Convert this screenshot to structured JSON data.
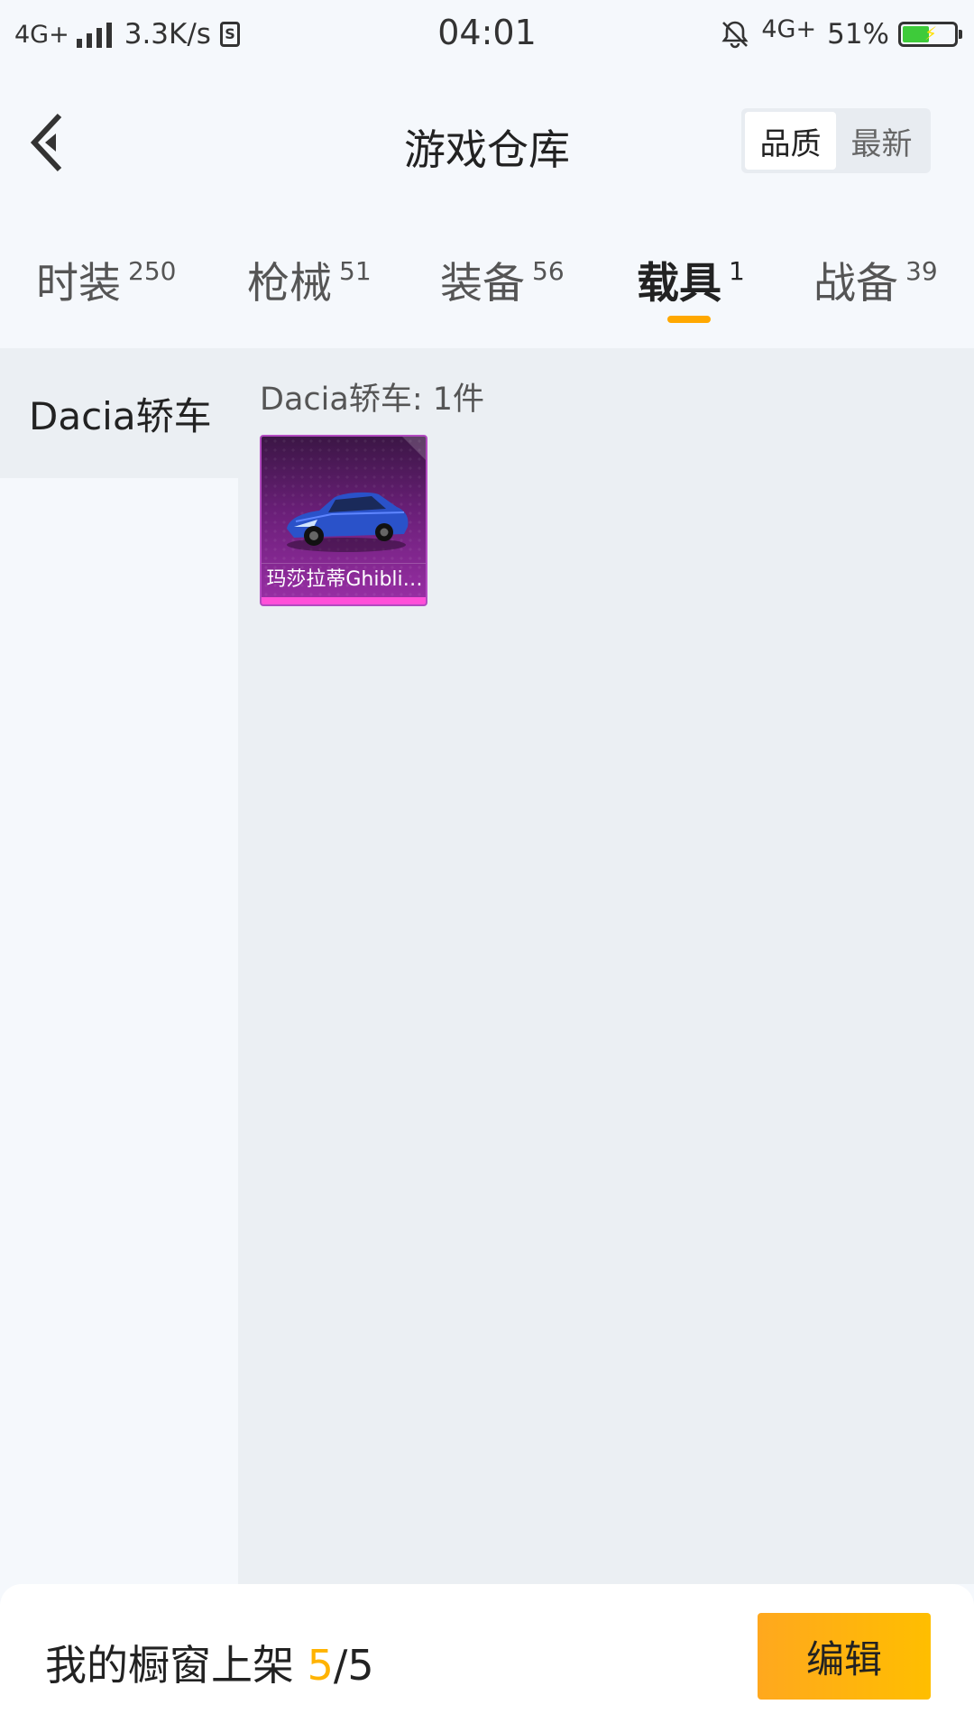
{
  "status_bar": {
    "network_left": "4G+",
    "speed": "3.3K/s",
    "sim_glyph": "S",
    "time": "04:01",
    "network_right": "4G+",
    "battery": "51%"
  },
  "header": {
    "title": "游戏仓库",
    "sort_options": [
      "品质",
      "最新"
    ]
  },
  "tabs": [
    {
      "label": "时装",
      "count": "250"
    },
    {
      "label": "枪械",
      "count": "51"
    },
    {
      "label": "装备",
      "count": "56"
    },
    {
      "label": "载具",
      "count": "1"
    },
    {
      "label": "战备",
      "count": "39"
    }
  ],
  "sidebar": {
    "items": [
      {
        "label": "Dacia轿车"
      }
    ]
  },
  "content": {
    "group_label": "Dacia轿车: 1件",
    "items": [
      {
        "name": "玛莎拉蒂Ghibli…"
      }
    ]
  },
  "bottom_bar": {
    "shelf_prefix": "我的橱窗上架 ",
    "shelf_current": "5",
    "shelf_total": "/5",
    "edit_label": "编辑"
  },
  "colors": {
    "accent": "#ffa800",
    "item_rarity": "#ff4fd8"
  }
}
